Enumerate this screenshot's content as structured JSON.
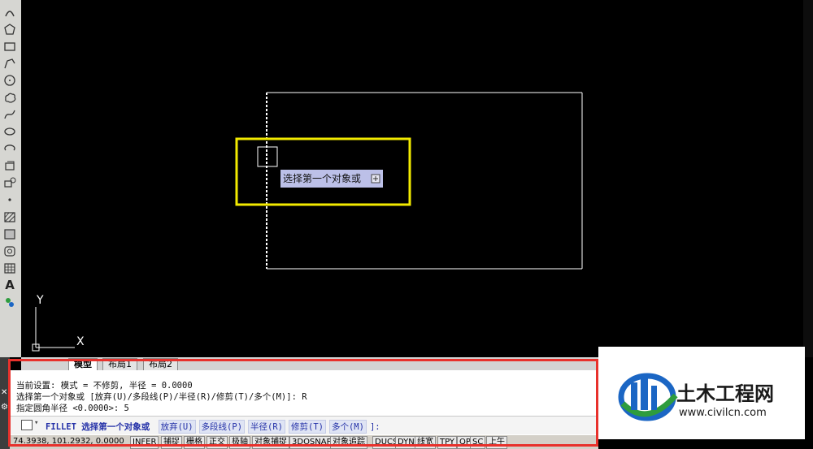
{
  "canvas": {
    "axis_y_label": "Y",
    "axis_x_label": "X",
    "tooltip_text": "选择第一个对象或",
    "colors": {
      "background": "#000000",
      "geometry": "#ffffff",
      "highlight_box": "#f2ea00",
      "tooltip_bg": "#bcc0e8"
    }
  },
  "toolbar": {
    "tools": [
      "arc-icon",
      "polygon-icon",
      "rectangle-icon",
      "polyline-icon",
      "circle-icon",
      "revision-cloud-icon",
      "spline-icon",
      "ellipse-icon",
      "ellipse-arc-icon",
      "insert-block-icon",
      "make-block-icon",
      "point-icon",
      "hatch-icon",
      "gradient-icon",
      "region-icon",
      "table-icon",
      "multiline-text-icon",
      "add-selected-icon"
    ],
    "text_icon_glyph": "A"
  },
  "tabs": [
    "模型",
    "布局1",
    "布局2"
  ],
  "command": {
    "history": [
      "当前设置: 模式 = 不修剪, 半径 = 0.0000",
      "选择第一个对象或 [放弃(U)/多段线(P)/半径(R)/修剪(T)/多个(M)]: R",
      "指定圆角半径 <0.0000>: 5"
    ],
    "prompt_command": "FILLET 选择第一个对象或",
    "options": [
      "放弃(U)",
      "多段线(P)",
      "半径(R)",
      "修剪(T)",
      "多个(M)"
    ],
    "prompt_end": "]:"
  },
  "status_bar": {
    "coordinates": "74.3938, 101.2932, 0.0000",
    "toggles": [
      "INFER",
      "捕捉",
      "栅格",
      "正交",
      "极轴",
      "对象捕捉",
      "3DOSNAP",
      "对象追踪",
      "DUCS",
      "DYN",
      "线宽",
      "TPY",
      "QP",
      "SC",
      "上午"
    ]
  },
  "watermark": {
    "brand": "土木工程网",
    "url": "www.civilcn.com",
    "colors": {
      "blue": "#1b66c4",
      "green": "#2e9c3e",
      "dark": "#1a1a1a"
    }
  }
}
